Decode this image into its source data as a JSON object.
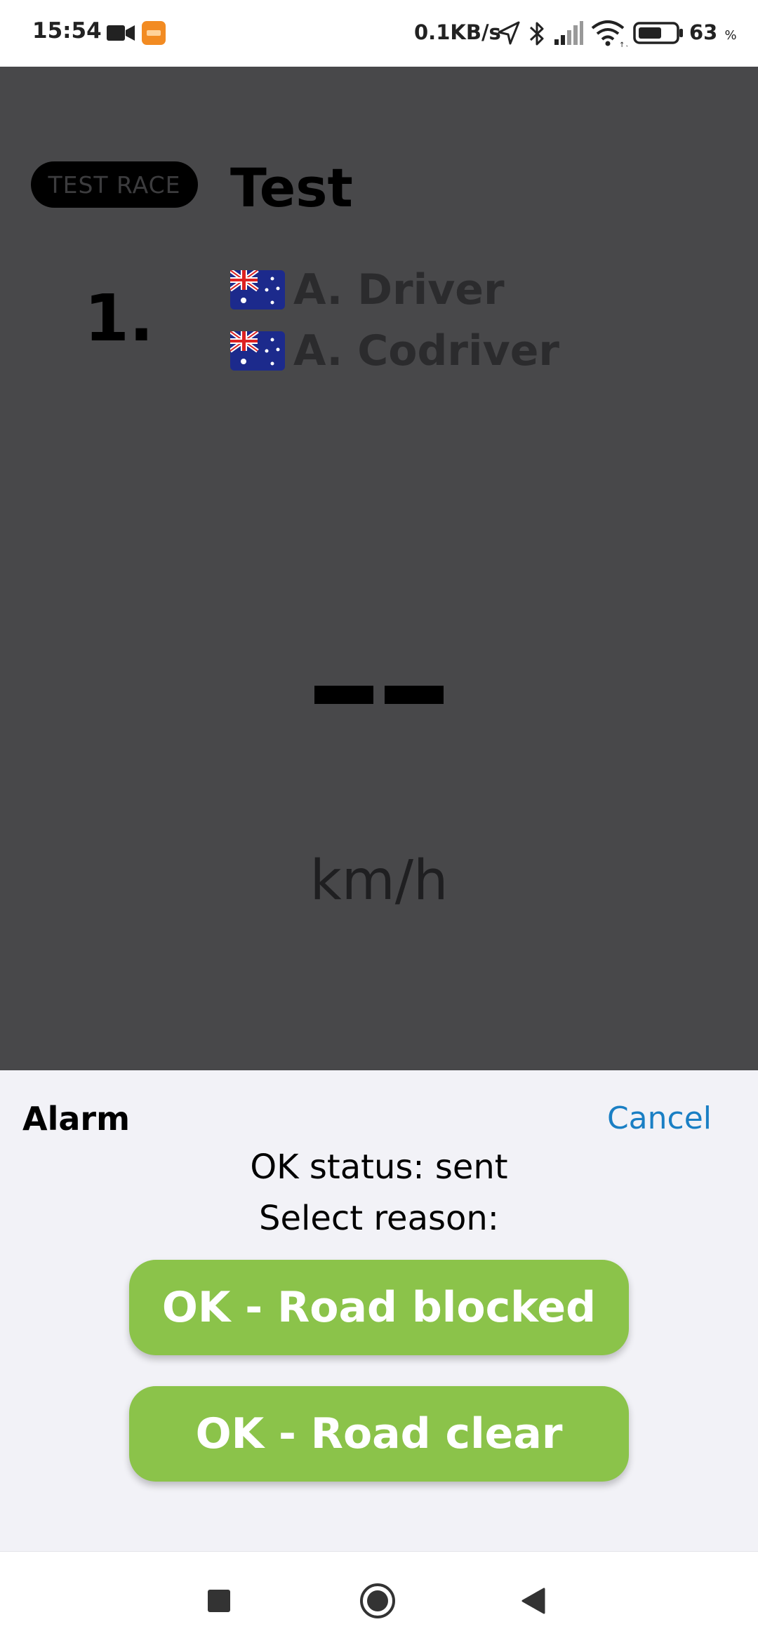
{
  "status_bar": {
    "time": "15:54",
    "network_speed": "0.1KB/s",
    "battery_level": "63",
    "battery_unit": "%",
    "battery_fraction": 0.63,
    "icons": [
      "video-camera-icon",
      "app-notification-icon",
      "location-arrow-icon",
      "bluetooth-icon",
      "cell-signal-icon",
      "wifi-icon",
      "battery-icon"
    ]
  },
  "race": {
    "badge": "TEST RACE",
    "title": "Test",
    "position": "1.",
    "crew": [
      {
        "flag": "australia-flag-icon",
        "name": "A. Driver"
      },
      {
        "flag": "australia-flag-icon",
        "name": "A. Codriver"
      }
    ],
    "speed_value_icon": "dash-dash-placeholder",
    "speed_unit": "km/h"
  },
  "sheet": {
    "title": "Alarm",
    "cancel_label": "Cancel",
    "status_text": "OK status: sent",
    "prompt": "Select reason:",
    "buttons": [
      {
        "label": "OK - Road blocked"
      },
      {
        "label": "OK - Road clear"
      }
    ]
  },
  "nav_bar": {
    "icons": [
      "recent-apps-icon",
      "home-icon",
      "back-icon"
    ]
  },
  "colors": {
    "overlay": "#48484a",
    "sheet_background": "#f2f2f7",
    "button_green": "#8bc34a",
    "link_blue": "#1a7fc4"
  }
}
